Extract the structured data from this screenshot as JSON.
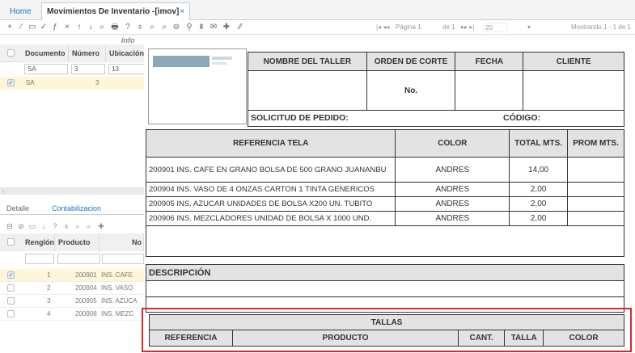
{
  "tabs": {
    "home": "Home",
    "window": "Movimientos De Inventario -[imov]",
    "close": "×"
  },
  "toolbar": {
    "icons": [
      "+",
      "∕",
      "▭",
      "✓",
      "ƒ",
      "×",
      "↑",
      "↓",
      "⌕",
      "🖶",
      "?",
      "⌽",
      "⌕",
      "⌕",
      "⊜",
      "⚲",
      "⇟",
      "✉",
      "✚",
      "⁄⁄"
    ],
    "pager_prefix": "|◂ ◂◂",
    "page_label": "Página 1",
    "of_label": "de 1",
    "pager_suffix": "▸▸ ▸|",
    "page_size": "20",
    "showing": "Mostrando 1 - 1 de 1"
  },
  "master": {
    "info_label": "Info",
    "columns": [
      "Documento",
      "Número",
      "Ubicación"
    ],
    "filter": [
      "SA",
      "3",
      "13"
    ],
    "row": {
      "documento": "SA",
      "numero": "3",
      "checked": "✓"
    }
  },
  "detail": {
    "tabs": [
      "Detalle",
      "Contabilizacion"
    ],
    "toolbar": [
      "⊟",
      "⊘",
      "▭",
      "↓",
      "?",
      "⌽",
      "⌕",
      "⌕",
      "✚"
    ],
    "columns": [
      "Renglón",
      "Producto",
      "No"
    ],
    "rows": [
      {
        "renglon": "1",
        "producto": "200901",
        "nombre": "INS. CAFE",
        "checked": "✓"
      },
      {
        "renglon": "2",
        "producto": "200904",
        "nombre": "INS. VASO",
        "checked": ""
      },
      {
        "renglon": "3",
        "producto": "200905",
        "nombre": "INS. AZUCA",
        "checked": ""
      },
      {
        "renglon": "4",
        "producto": "200906",
        "nombre": "INS. MEZC",
        "checked": ""
      }
    ]
  },
  "report": {
    "header_cols": [
      "NOMBRE DEL TALLER",
      "ORDEN DE CORTE",
      "FECHA",
      "CLIENTE"
    ],
    "no_label": "No.",
    "solicitud_label": "SOLICITUD DE PEDIDO:",
    "codigo_label": "CÓDIGO:",
    "items_cols": [
      "REFERENCIA TELA",
      "COLOR",
      "TOTAL MTS.",
      "PROM MTS."
    ],
    "items": [
      {
        "ref": "200901 INS. CAFE EN GRANO BOLSA DE 500 GRANO JUANANBU",
        "color": "ANDRES",
        "total": "14,00",
        "prom": ""
      },
      {
        "ref": "200904 INS. VASO DE 4 ONZAS CARTON 1 TINTA GENERICOS",
        "color": "ANDRES",
        "total": "2,00",
        "prom": ""
      },
      {
        "ref": "200905 INS. AZUCAR UNIDADES DE BOLSA X200 UN. TUBITO",
        "color": "ANDRES",
        "total": "2,00",
        "prom": ""
      },
      {
        "ref": "200906 INS. MEZCLADORES UNIDAD DE BOLSA X 1000 UND.",
        "color": "ANDRES",
        "total": "2,00",
        "prom": ""
      }
    ],
    "descripcion_label": "DESCRIPCIÓN",
    "tallas_label": "TALLAS",
    "tallas_cols": [
      "REFERENCIA",
      "PRODUCTO",
      "CANT.",
      "TALLA",
      "COLOR"
    ]
  },
  "colors": {
    "accent": "#1a73c5",
    "highlight": "#d9292e",
    "selected_row": "#fdf6d8"
  }
}
